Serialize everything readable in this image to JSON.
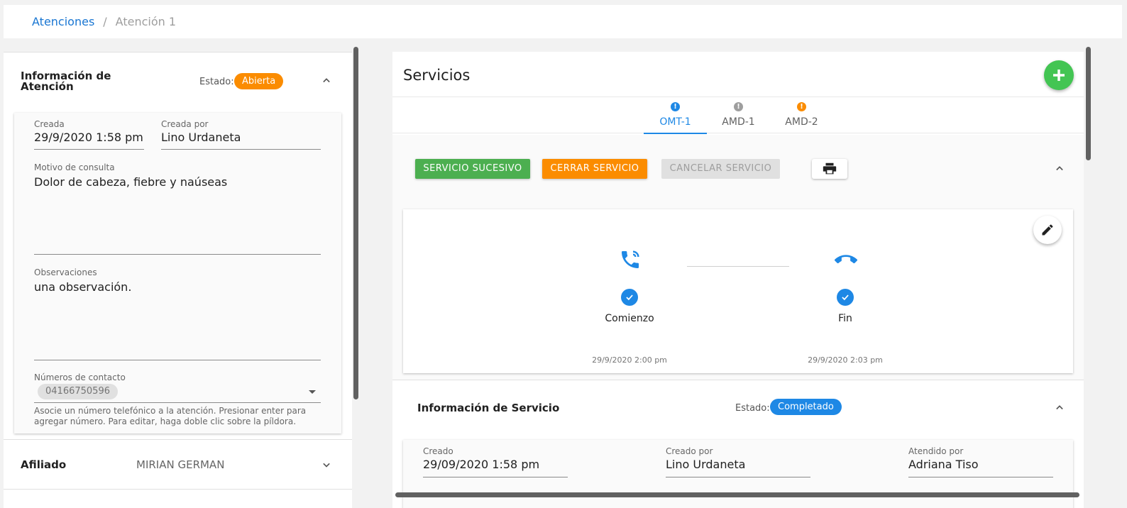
{
  "breadcrumb": {
    "root": "Atenciones",
    "separator": "/",
    "current": "Atención 1"
  },
  "attention": {
    "title": "Información de Atención",
    "estado_label": "Estado:",
    "estado_value": "Abierta",
    "estado_color": "#fb8c00",
    "creada_label": "Creada",
    "creada_value": "29/9/2020 1:58 pm",
    "creada_por_label": "Creada por",
    "creada_por_value": "Lino Urdaneta",
    "motivo_label": "Motivo de consulta",
    "motivo_value": "Dolor de cabeza, fiebre y naúseas",
    "observaciones_label": "Observaciones",
    "observaciones_value": "una observación.",
    "contacto_label": "Números de contacto",
    "contacto_numbers": [
      "04166750596"
    ],
    "contacto_hint_1": "Asocie un número telefónico a la atención. Presionar enter para",
    "contacto_hint_2": "agregar número. Para editar, haga doble clic sobre la píldora."
  },
  "afiliado": {
    "label": "Afiliado",
    "value": "MIRIAN GERMAN"
  },
  "services": {
    "title": "Servicios",
    "add_icon": "plus-icon",
    "tabs": [
      {
        "label": "OMT-1",
        "dot_color": "#1e88e5",
        "active": true
      },
      {
        "label": "AMD-1",
        "dot_color": "#9e9e9e",
        "active": false
      },
      {
        "label": "AMD-2",
        "dot_color": "#fb8c00",
        "active": false
      }
    ],
    "btn_sucesivo": "SERVICIO SUCESIVO",
    "btn_cerrar": "CERRAR SERVICIO",
    "btn_cancelar": "CANCELAR SERVICIO",
    "print_icon": "printer-icon",
    "timeline": {
      "start_label": "Comienzo",
      "start_date": "29/9/2020 2:00 pm",
      "end_label": "Fin",
      "end_date": "29/9/2020 2:03 pm"
    },
    "info": {
      "title": "Información de Servicio",
      "estado_label": "Estado:",
      "estado_value": "Completado",
      "estado_color": "#1e88e5",
      "creado_label": "Creado",
      "creado_value": "29/09/2020 1:58 pm",
      "creado_por_label": "Creado por",
      "creado_por_value": "Lino Urdaneta",
      "atendido_label": "Atendido por",
      "atendido_value": "Adriana Tiso"
    }
  },
  "colors": {
    "primary": "#1976d2",
    "success": "#43a047",
    "warning": "#fb8c00",
    "disabled": "#e0e0e0"
  }
}
